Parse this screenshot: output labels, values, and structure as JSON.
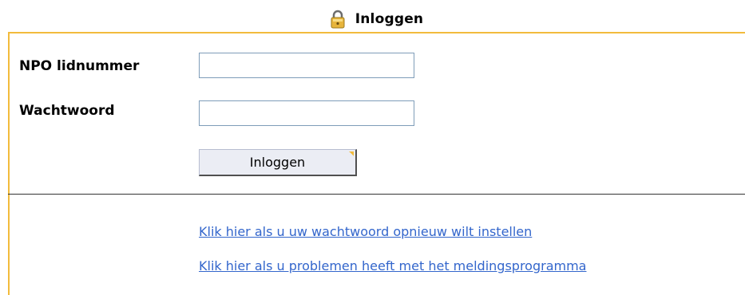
{
  "header": {
    "icon": "lock-icon",
    "title": "Inloggen"
  },
  "form": {
    "member_label": "NPO lidnummer",
    "member_value": "",
    "password_label": "Wachtwoord",
    "password_value": "",
    "submit_label": "Inloggen"
  },
  "links": {
    "reset_password": "Klik hier als u uw wachtwoord opnieuw wilt instellen",
    "report_problems": "Klik hier als u problemen heeft met het meldingsprogramma"
  },
  "colors": {
    "panel_border": "#f2bb3c",
    "link": "#3366cc",
    "input_border": "#7f9db9",
    "button_bg": "#ebedf4"
  }
}
